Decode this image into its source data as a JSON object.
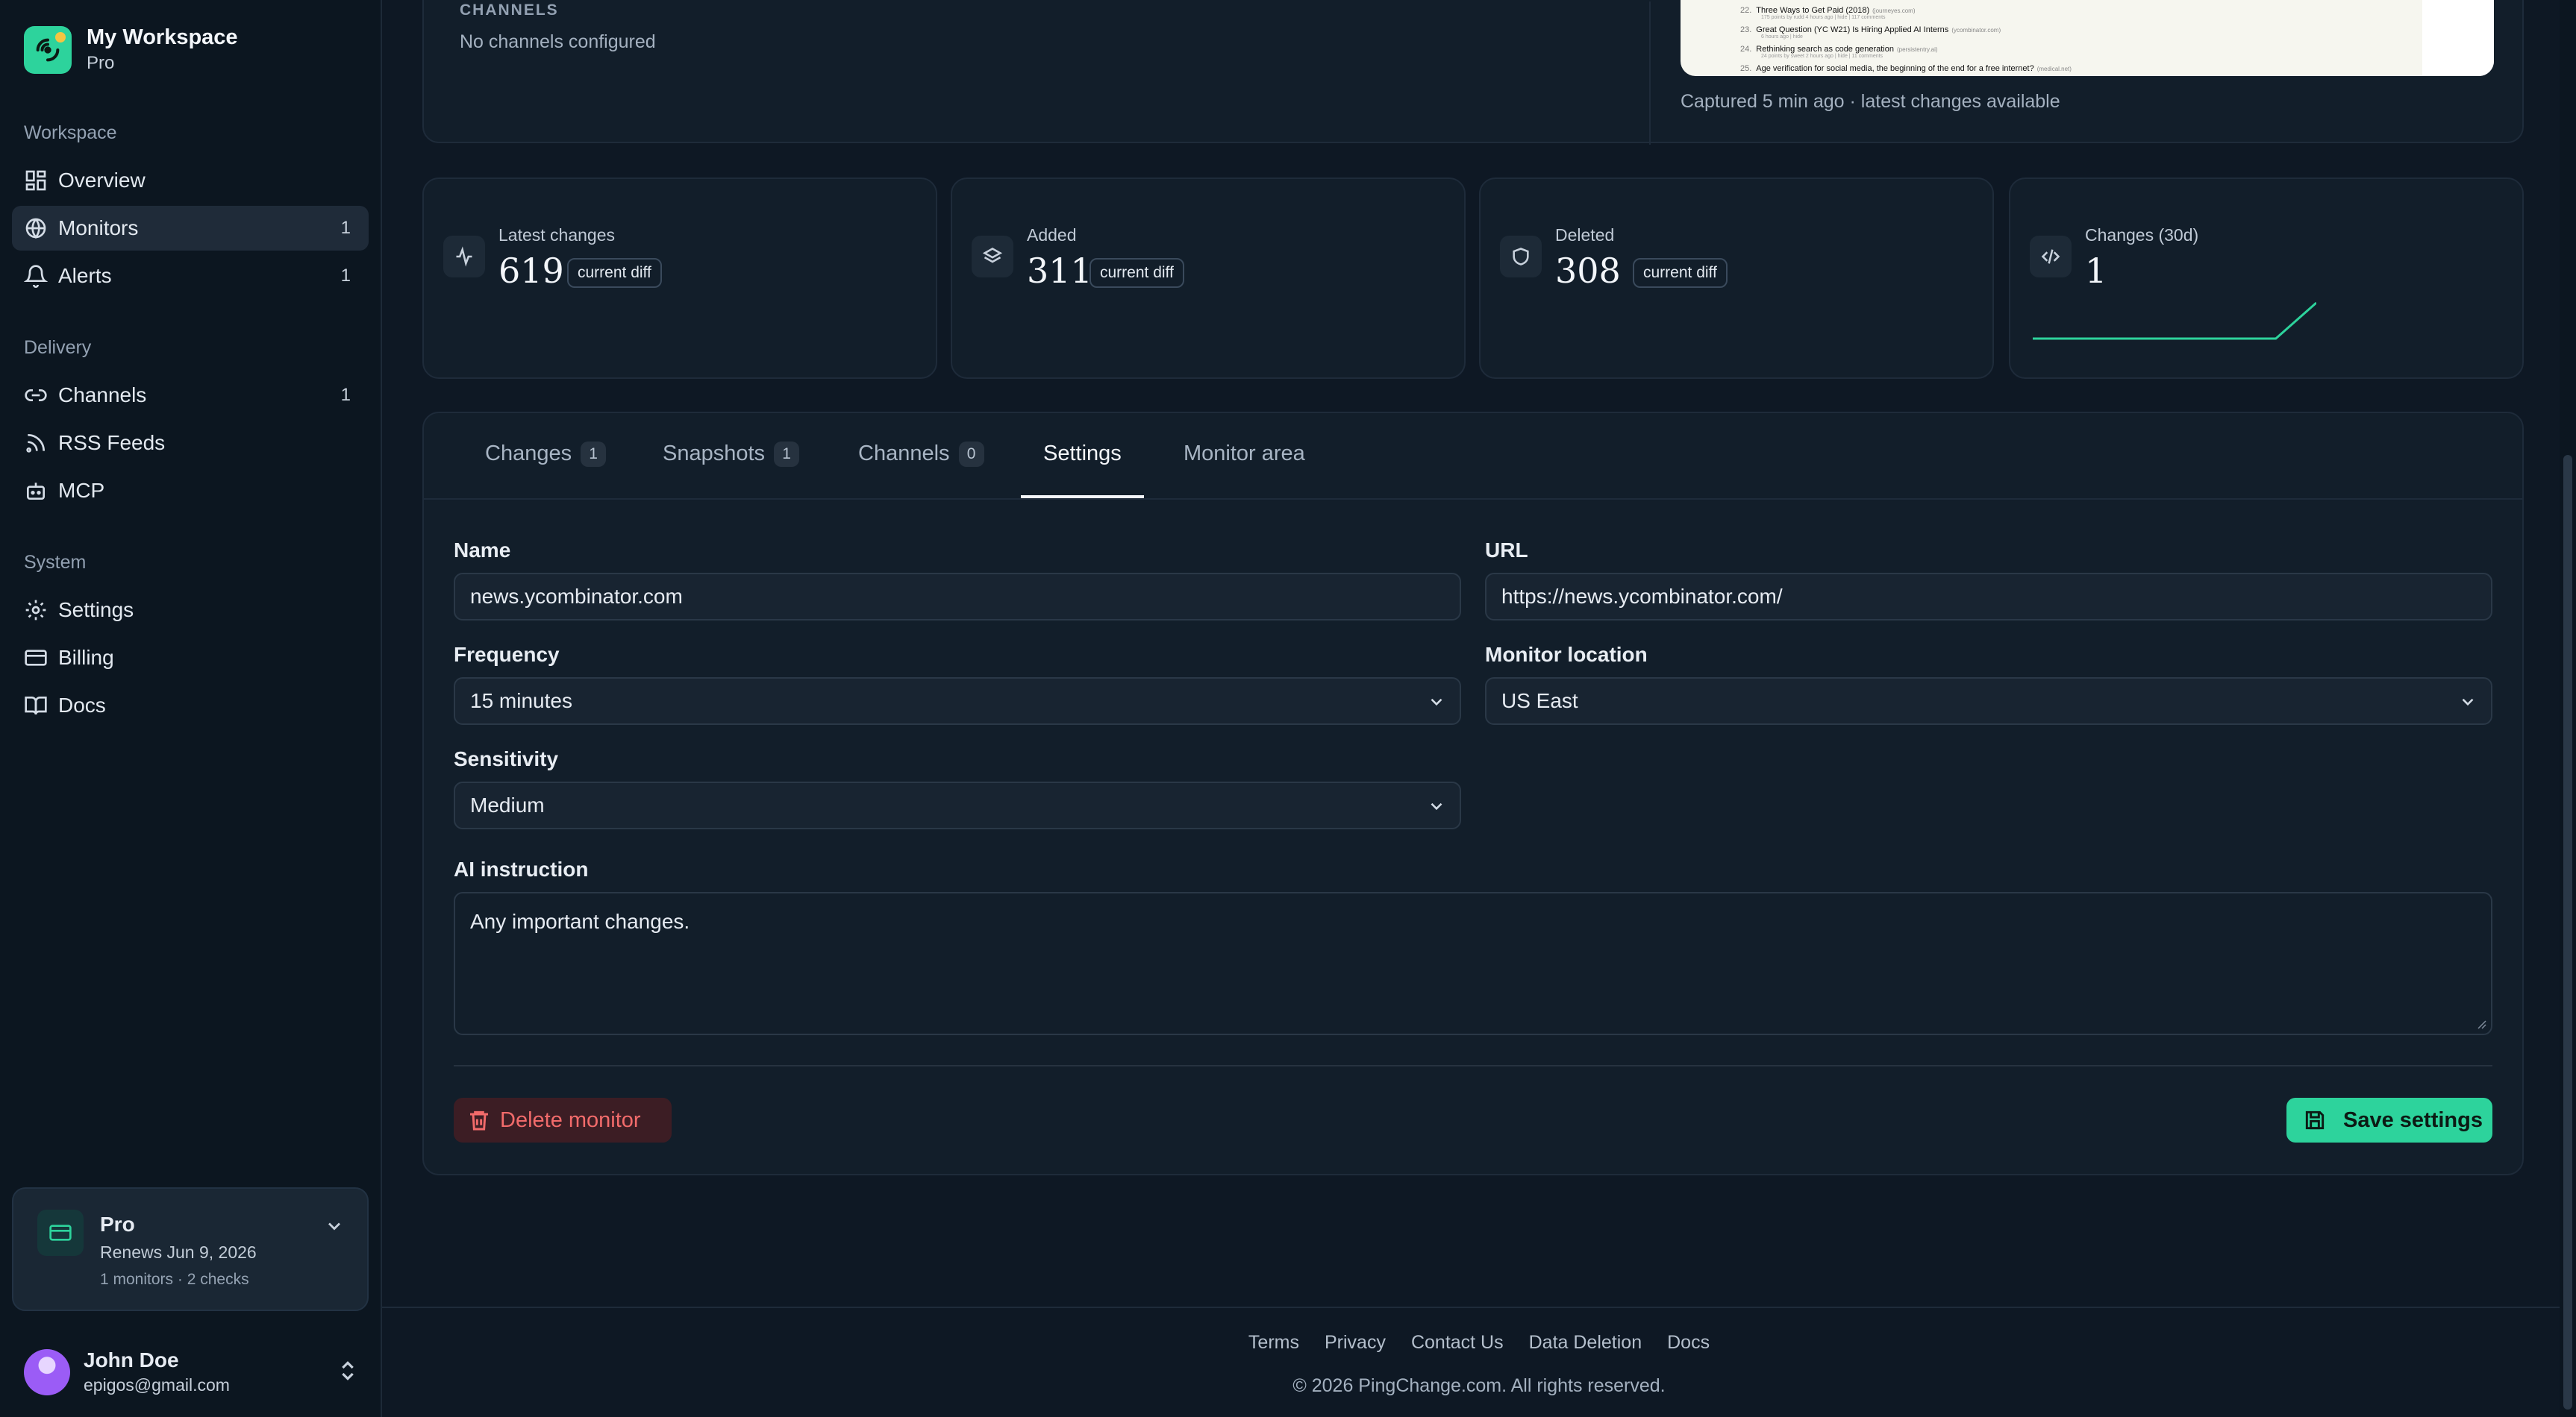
{
  "workspace": {
    "name": "My Workspace",
    "plan": "Pro"
  },
  "nav": {
    "workspace_label": "Workspace",
    "overview": "Overview",
    "monitors": "Monitors",
    "monitors_count": "1",
    "alerts": "Alerts",
    "alerts_count": "1",
    "delivery_label": "Delivery",
    "channels": "Channels",
    "channels_count": "1",
    "rss": "RSS Feeds",
    "mcp": "MCP",
    "system_label": "System",
    "settings": "Settings",
    "billing": "Billing",
    "docs": "Docs"
  },
  "plan_card": {
    "title": "Pro",
    "renews": "Renews Jun 9, 2026",
    "meta": "1 monitors · 2 checks"
  },
  "user": {
    "name": "John Doe",
    "email": "epigos@gmail.com"
  },
  "channels_section": {
    "label": "CHANNELS",
    "empty": "No channels configured"
  },
  "snapshot": {
    "rows": [
      {
        "num": "22.",
        "title": "Three Ways to Get Paid (2018)",
        "domain": "(journeyes.com)",
        "sub": "175 points by rudd 4 hours ago | hide | 117 comments"
      },
      {
        "num": "23.",
        "title": "Great Question (YC W21) Is Hiring Applied AI Interns",
        "domain": "(ycombinator.com)",
        "sub": "6 hours ago | hide"
      },
      {
        "num": "24.",
        "title": "Rethinking search as code generation",
        "domain": "(persistentry.ai)",
        "sub": "24 points by sweet 2 hours ago | hide | 11 comments"
      },
      {
        "num": "25.",
        "title": "Age verification for social media, the beginning of the end for a free internet?",
        "domain": "(medical.net)",
        "sub": ""
      }
    ],
    "caption": "Captured 5 min ago · latest changes available"
  },
  "stats": [
    {
      "label": "Latest changes",
      "value": "619",
      "pill": "current diff",
      "icon": "activity-icon"
    },
    {
      "label": "Added",
      "value": "311",
      "pill": "current diff",
      "icon": "layers-icon"
    },
    {
      "label": "Deleted",
      "value": "308",
      "pill": "current diff",
      "icon": "shield-icon"
    },
    {
      "label": "Changes (30d)",
      "value": "1",
      "icon": "code-icon",
      "sparkline": [
        0,
        0,
        0,
        0,
        0,
        0,
        0,
        1
      ]
    }
  ],
  "tabs": [
    {
      "label": "Changes",
      "count": "1"
    },
    {
      "label": "Snapshots",
      "count": "1"
    },
    {
      "label": "Channels",
      "count": "0"
    },
    {
      "label": "Settings",
      "active": true
    },
    {
      "label": "Monitor area"
    }
  ],
  "form": {
    "name_label": "Name",
    "name_value": "news.ycombinator.com",
    "url_label": "URL",
    "url_value": "https://news.ycombinator.com/",
    "frequency_label": "Frequency",
    "frequency_value": "15 minutes",
    "location_label": "Monitor location",
    "location_value": "US East",
    "sensitivity_label": "Sensitivity",
    "sensitivity_value": "Medium",
    "ai_label": "AI instruction",
    "ai_value": "Any important changes."
  },
  "actions": {
    "delete": "Delete monitor",
    "save": "Save settings"
  },
  "footer": {
    "links": [
      "Terms",
      "Privacy",
      "Contact Us",
      "Data Deletion",
      "Docs"
    ],
    "copyright": "© 2026 PingChange.com. All rights reserved."
  },
  "colors": {
    "accent": "#2dd39c",
    "danger": "#f26b6b",
    "background": "#0e1824",
    "panel": "#121e2a"
  }
}
